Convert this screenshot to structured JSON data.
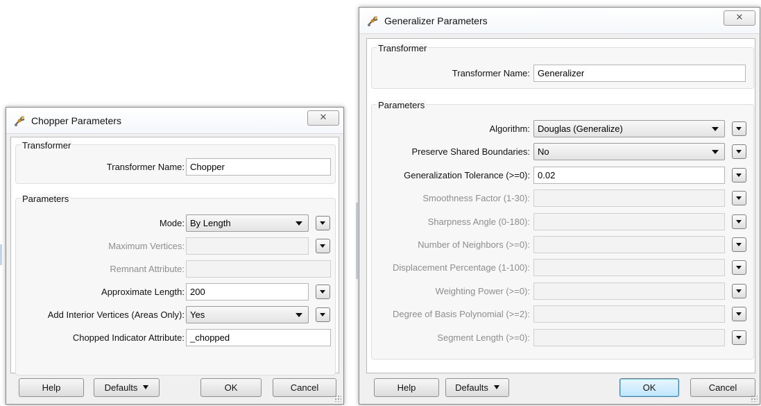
{
  "chopper": {
    "title": "Chopper Parameters",
    "close_glyph": "✕",
    "transformer_group": "Transformer",
    "transformer_name_label": "Transformer Name:",
    "transformer_name_value": "Chopper",
    "parameters_group": "Parameters",
    "rows": [
      {
        "label": "Mode:",
        "value": "By Length",
        "kind": "combo",
        "enabled": true,
        "menu": true
      },
      {
        "label": "Maximum Vertices:",
        "value": "",
        "kind": "field",
        "enabled": false,
        "menu": true
      },
      {
        "label": "Remnant Attribute:",
        "value": "",
        "kind": "field",
        "enabled": false,
        "menu": false
      },
      {
        "label": "Approximate Length:",
        "value": "200",
        "kind": "field",
        "enabled": true,
        "menu": true
      },
      {
        "label": "Add Interior Vertices (Areas Only):",
        "value": "Yes",
        "kind": "combo",
        "enabled": true,
        "menu": true
      },
      {
        "label": "Chopped Indicator Attribute:",
        "value": "_chopped",
        "kind": "field",
        "enabled": true,
        "menu": false
      }
    ],
    "buttons": {
      "help": "Help",
      "defaults": "Defaults",
      "ok": "OK",
      "cancel": "Cancel"
    }
  },
  "generalizer": {
    "title": "Generalizer Parameters",
    "close_glyph": "✕",
    "transformer_group": "Transformer",
    "transformer_name_label": "Transformer Name:",
    "transformer_name_value": "Generalizer",
    "parameters_group": "Parameters",
    "rows": [
      {
        "label": "Algorithm:",
        "value": "Douglas (Generalize)",
        "kind": "combo",
        "enabled": true
      },
      {
        "label": "Preserve Shared Boundaries:",
        "value": "No",
        "kind": "combo",
        "enabled": true
      },
      {
        "label": "Generalization Tolerance (>=0):",
        "value": "0.02",
        "kind": "field",
        "enabled": true
      },
      {
        "label": "Smoothness Factor (1-30):",
        "value": "",
        "kind": "field",
        "enabled": false
      },
      {
        "label": "Sharpness Angle (0-180):",
        "value": "",
        "kind": "field",
        "enabled": false
      },
      {
        "label": "Number of Neighbors (>=0):",
        "value": "",
        "kind": "field",
        "enabled": false
      },
      {
        "label": "Displacement Percentage (1-100):",
        "value": "",
        "kind": "field",
        "enabled": false
      },
      {
        "label": "Weighting Power (>=0):",
        "value": "",
        "kind": "field",
        "enabled": false
      },
      {
        "label": "Degree of Basis Polynomial (>=2):",
        "value": "",
        "kind": "field",
        "enabled": false
      },
      {
        "label": "Segment Length (>=0):",
        "value": "",
        "kind": "field",
        "enabled": false
      }
    ],
    "buttons": {
      "help": "Help",
      "defaults": "Defaults",
      "ok": "OK",
      "cancel": "Cancel"
    }
  }
}
